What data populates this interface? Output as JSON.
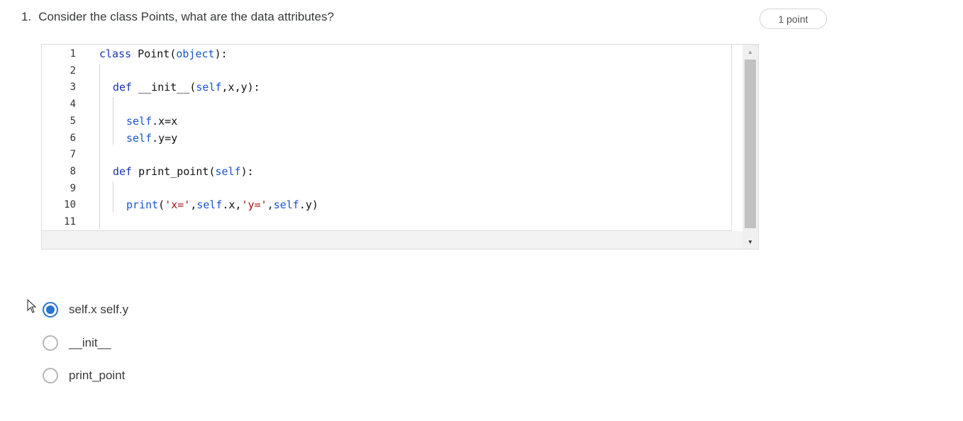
{
  "question": {
    "number": "1.",
    "text": "Consider the class Points, what are the data attributes?",
    "points": "1 point"
  },
  "code": {
    "line_numbers": [
      "1",
      "2",
      "3",
      "4",
      "5",
      "6",
      "7",
      "8",
      "9",
      "10",
      "11"
    ],
    "lines": [
      {
        "indent": 0,
        "tokens": [
          {
            "t": "class",
            "c": "kw"
          },
          {
            "t": " Point(",
            "c": ""
          },
          {
            "t": "object",
            "c": "bi"
          },
          {
            "t": "):",
            "c": ""
          }
        ]
      },
      {
        "indent": 0,
        "tokens": []
      },
      {
        "indent": 1,
        "tokens": [
          {
            "t": "def",
            "c": "kw"
          },
          {
            "t": " __init__(",
            "c": ""
          },
          {
            "t": "self",
            "c": "bi"
          },
          {
            "t": ",x,y):",
            "c": ""
          }
        ]
      },
      {
        "indent": 1,
        "tokens": []
      },
      {
        "indent": 2,
        "tokens": [
          {
            "t": "self",
            "c": "bi"
          },
          {
            "t": ".x=x",
            "c": ""
          }
        ]
      },
      {
        "indent": 2,
        "tokens": [
          {
            "t": "self",
            "c": "bi"
          },
          {
            "t": ".y=y",
            "c": ""
          }
        ]
      },
      {
        "indent": 0,
        "tokens": []
      },
      {
        "indent": 1,
        "tokens": [
          {
            "t": "def",
            "c": "kw"
          },
          {
            "t": " print_point(",
            "c": ""
          },
          {
            "t": "self",
            "c": "bi"
          },
          {
            "t": "):",
            "c": ""
          }
        ]
      },
      {
        "indent": 1,
        "tokens": []
      },
      {
        "indent": 2,
        "tokens": [
          {
            "t": "print",
            "c": "bi"
          },
          {
            "t": "(",
            "c": ""
          },
          {
            "t": "'x='",
            "c": "str"
          },
          {
            "t": ",",
            "c": ""
          },
          {
            "t": "self",
            "c": "bi"
          },
          {
            "t": ".x,",
            "c": ""
          },
          {
            "t": "'y='",
            "c": "str"
          },
          {
            "t": ",",
            "c": ""
          },
          {
            "t": "self",
            "c": "bi"
          },
          {
            "t": ".y)",
            "c": ""
          }
        ]
      },
      {
        "indent": 0,
        "tokens": []
      }
    ]
  },
  "options": [
    {
      "label": "self.x self.y",
      "checked": true
    },
    {
      "label": "__init__",
      "checked": false
    },
    {
      "label": "print_point",
      "checked": false
    }
  ],
  "colors": {
    "accent": "#2a73cc",
    "keyword": "#1a34b3",
    "string": "#a11111"
  }
}
